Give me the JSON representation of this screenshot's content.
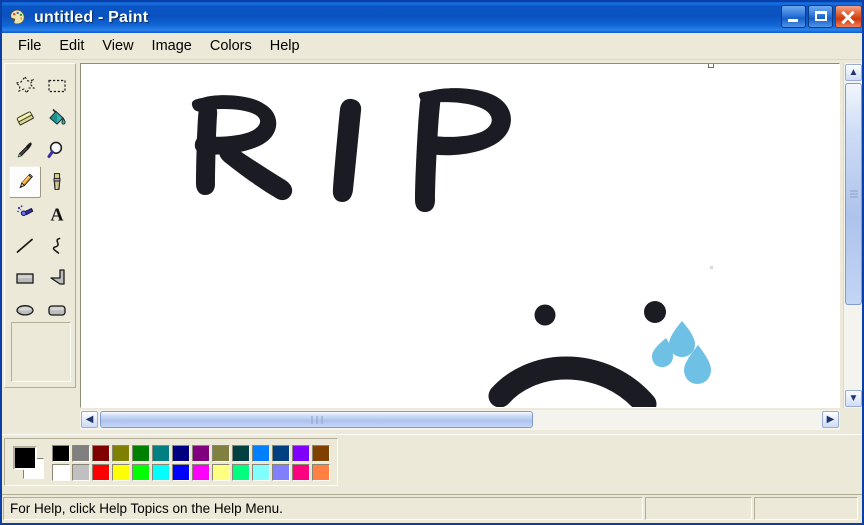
{
  "window": {
    "title": "untitled - Paint",
    "icon": "paint-palette-icon",
    "titlebar_color": "#0a52c0",
    "controls": {
      "minimize_label": "Minimize",
      "maximize_label": "Maximize",
      "close_label": "Close"
    }
  },
  "menubar": {
    "items": [
      {
        "label": "File"
      },
      {
        "label": "Edit"
      },
      {
        "label": "View"
      },
      {
        "label": "Image"
      },
      {
        "label": "Colors"
      },
      {
        "label": "Help"
      }
    ]
  },
  "toolbox": {
    "selected": "pencil",
    "tools": [
      {
        "id": "free-form-select",
        "label": "Free-Form Select",
        "icon": "free-form-select-icon"
      },
      {
        "id": "select",
        "label": "Select",
        "icon": "rectangle-select-icon"
      },
      {
        "id": "eraser",
        "label": "Eraser/Color Eraser",
        "icon": "eraser-icon"
      },
      {
        "id": "fill",
        "label": "Fill With Color",
        "icon": "paint-bucket-icon"
      },
      {
        "id": "pick-color",
        "label": "Pick Color",
        "icon": "eyedropper-icon"
      },
      {
        "id": "magnifier",
        "label": "Magnifier",
        "icon": "magnifier-icon"
      },
      {
        "id": "pencil",
        "label": "Pencil",
        "icon": "pencil-icon"
      },
      {
        "id": "brush",
        "label": "Brush",
        "icon": "brush-icon"
      },
      {
        "id": "airbrush",
        "label": "Airbrush",
        "icon": "airbrush-icon"
      },
      {
        "id": "text",
        "label": "Text",
        "icon": "text-a-icon"
      },
      {
        "id": "line",
        "label": "Line",
        "icon": "line-icon"
      },
      {
        "id": "curve",
        "label": "Curve",
        "icon": "curve-icon"
      },
      {
        "id": "rectangle",
        "label": "Rectangle",
        "icon": "rectangle-icon"
      },
      {
        "id": "polygon",
        "label": "Polygon",
        "icon": "polygon-icon"
      },
      {
        "id": "ellipse",
        "label": "Ellipse",
        "icon": "ellipse-icon"
      },
      {
        "id": "rounded-rectangle",
        "label": "Rounded Rectangle",
        "icon": "rounded-rectangle-icon"
      }
    ]
  },
  "canvas": {
    "background": "#ffffff",
    "drawing": {
      "description": "Hand-drawn RIP text above a crying sad face",
      "text_drawn": "RIP",
      "stroke_color": "#1b1b24",
      "tear_color": "#6ec1e4",
      "elements": [
        {
          "name": "letter-r",
          "color": "#1b1b24"
        },
        {
          "name": "letter-i",
          "color": "#1b1b24"
        },
        {
          "name": "letter-p",
          "color": "#1b1b24"
        },
        {
          "name": "left-eye",
          "color": "#1b1b24"
        },
        {
          "name": "right-eye",
          "color": "#1b1b24"
        },
        {
          "name": "frown-mouth",
          "color": "#1b1b24"
        },
        {
          "name": "tear-1",
          "color": "#6ec1e4"
        },
        {
          "name": "tear-2",
          "color": "#6ec1e4"
        },
        {
          "name": "tear-3",
          "color": "#6ec1e4"
        }
      ]
    }
  },
  "scrollbars": {
    "vertical": {
      "up_arrow": "▲",
      "down_arrow": "▼"
    },
    "horizontal": {
      "left_arrow": "◀",
      "right_arrow": "▶"
    }
  },
  "palette": {
    "foreground_color": "#000000",
    "background_color": "#ffffff",
    "row1": [
      "#000000",
      "#808080",
      "#800000",
      "#808000",
      "#008000",
      "#008080",
      "#000080",
      "#800080",
      "#808040",
      "#004040",
      "#0080ff",
      "#004080",
      "#8000ff",
      "#804000"
    ],
    "row2": [
      "#ffffff",
      "#c0c0c0",
      "#ff0000",
      "#ffff00",
      "#00ff00",
      "#00ffff",
      "#0000ff",
      "#ff00ff",
      "#ffff80",
      "#00ff80",
      "#80ffff",
      "#8080ff",
      "#ff0080",
      "#ff8040"
    ]
  },
  "statusbar": {
    "hint": "For Help, click Help Topics on the Help Menu.",
    "panel2": "",
    "panel3": ""
  }
}
